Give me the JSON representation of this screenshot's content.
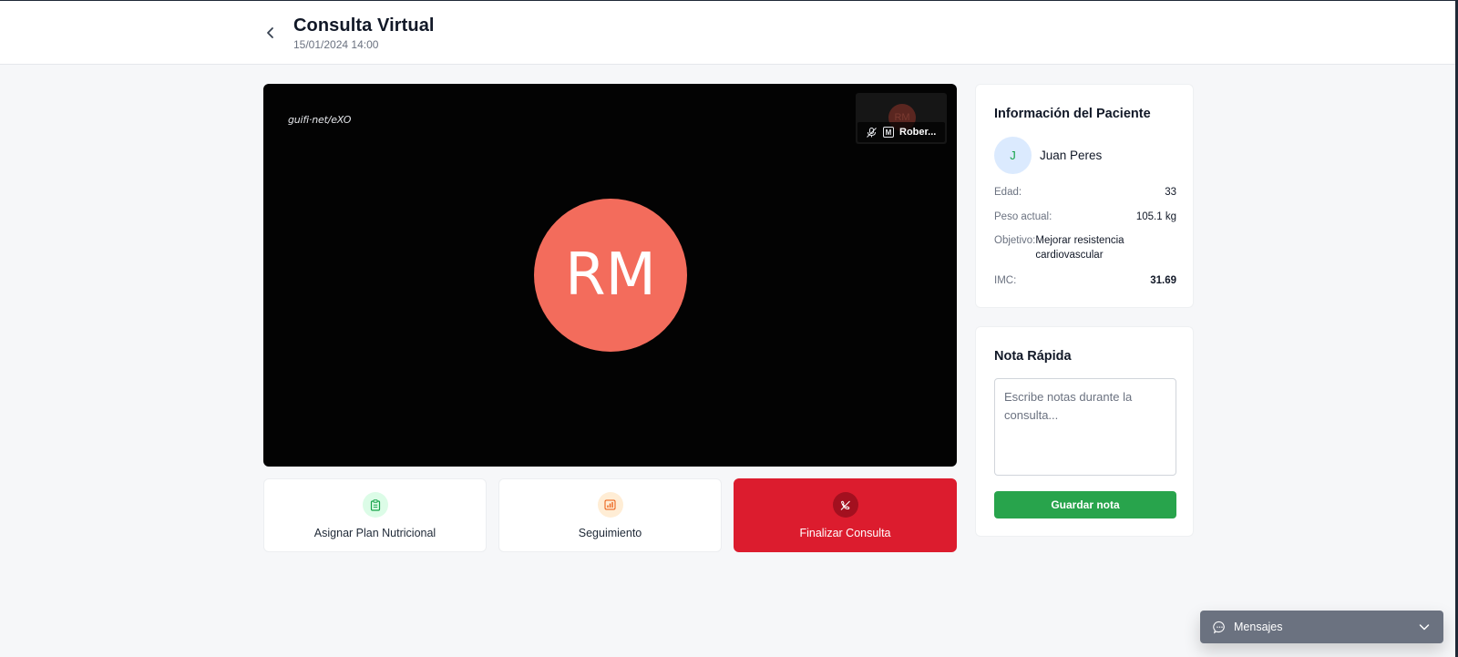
{
  "header": {
    "title": "Consulta Virtual",
    "datetime": "15/01/2024 14:00",
    "back_icon": "chevron-left-icon"
  },
  "video": {
    "watermark": "guifi·net/eXO",
    "main_initials": "RM",
    "main_avatar_color": "#f36c5c",
    "thumbnail": {
      "initials": "RM",
      "moderator_badge": "M",
      "name": "Rober..."
    }
  },
  "actions": {
    "assign_plan": {
      "label": "Asignar Plan Nutricional",
      "icon": "clipboard-icon"
    },
    "follow_up": {
      "label": "Seguimiento",
      "icon": "bar-chart-icon"
    },
    "end_call": {
      "label": "Finalizar Consulta",
      "icon": "phone-off-icon",
      "color": "#dc1c2e"
    }
  },
  "patient": {
    "section_title": "Información del Paciente",
    "initial": "J",
    "name": "Juan Peres",
    "rows": {
      "age": {
        "label": "Edad:",
        "value": "33"
      },
      "weight": {
        "label": "Peso actual:",
        "value": "105.1 kg"
      },
      "goal": {
        "label": "Objetivo:",
        "value": "Mejorar resistencia cardiovascular"
      },
      "bmi": {
        "label": "IMC:",
        "value": "31.69"
      }
    }
  },
  "quick_note": {
    "section_title": "Nota Rápida",
    "placeholder": "Escribe notas durante la consulta...",
    "value": "",
    "save_label": "Guardar nota",
    "save_color": "#28a44c"
  },
  "messages": {
    "label": "Mensajes",
    "icon": "chat-bubble-icon",
    "toggle_icon": "chevron-down-icon"
  }
}
